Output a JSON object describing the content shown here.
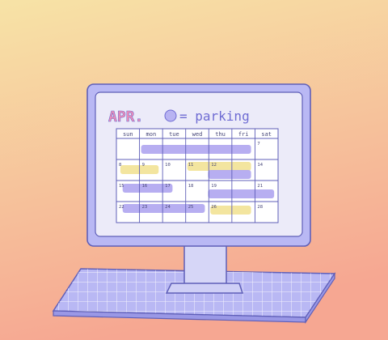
{
  "calendar": {
    "month": "APR.",
    "legend": "= parking",
    "days": [
      "sun",
      "mon",
      "tue",
      "wed",
      "thu",
      "fri",
      "sat"
    ],
    "dates": [
      [
        "",
        "",
        "",
        "",
        "",
        "",
        "7"
      ],
      [
        "8",
        "9",
        "10",
        "11",
        "12",
        "",
        "14"
      ],
      [
        "15",
        "16",
        "17",
        "18",
        "19",
        "",
        "21"
      ],
      [
        "22",
        "23",
        "24",
        "25",
        "26",
        "",
        "28"
      ]
    ]
  },
  "colors": {
    "bg_top": "#f7e3a6",
    "bg_bottom": "#f6a792",
    "monitor": "#b9b8f4",
    "outline": "#5f5fb8",
    "screen": "#ecebf9",
    "grid_bg": "#ffffff",
    "lavender": "#b3aaf0",
    "yellow": "#f2e49a",
    "month_pink": "#f08fb6",
    "legend_dot": "#b8b3f2",
    "legend_text": "#6f6cd3",
    "date_text": "#444477"
  }
}
